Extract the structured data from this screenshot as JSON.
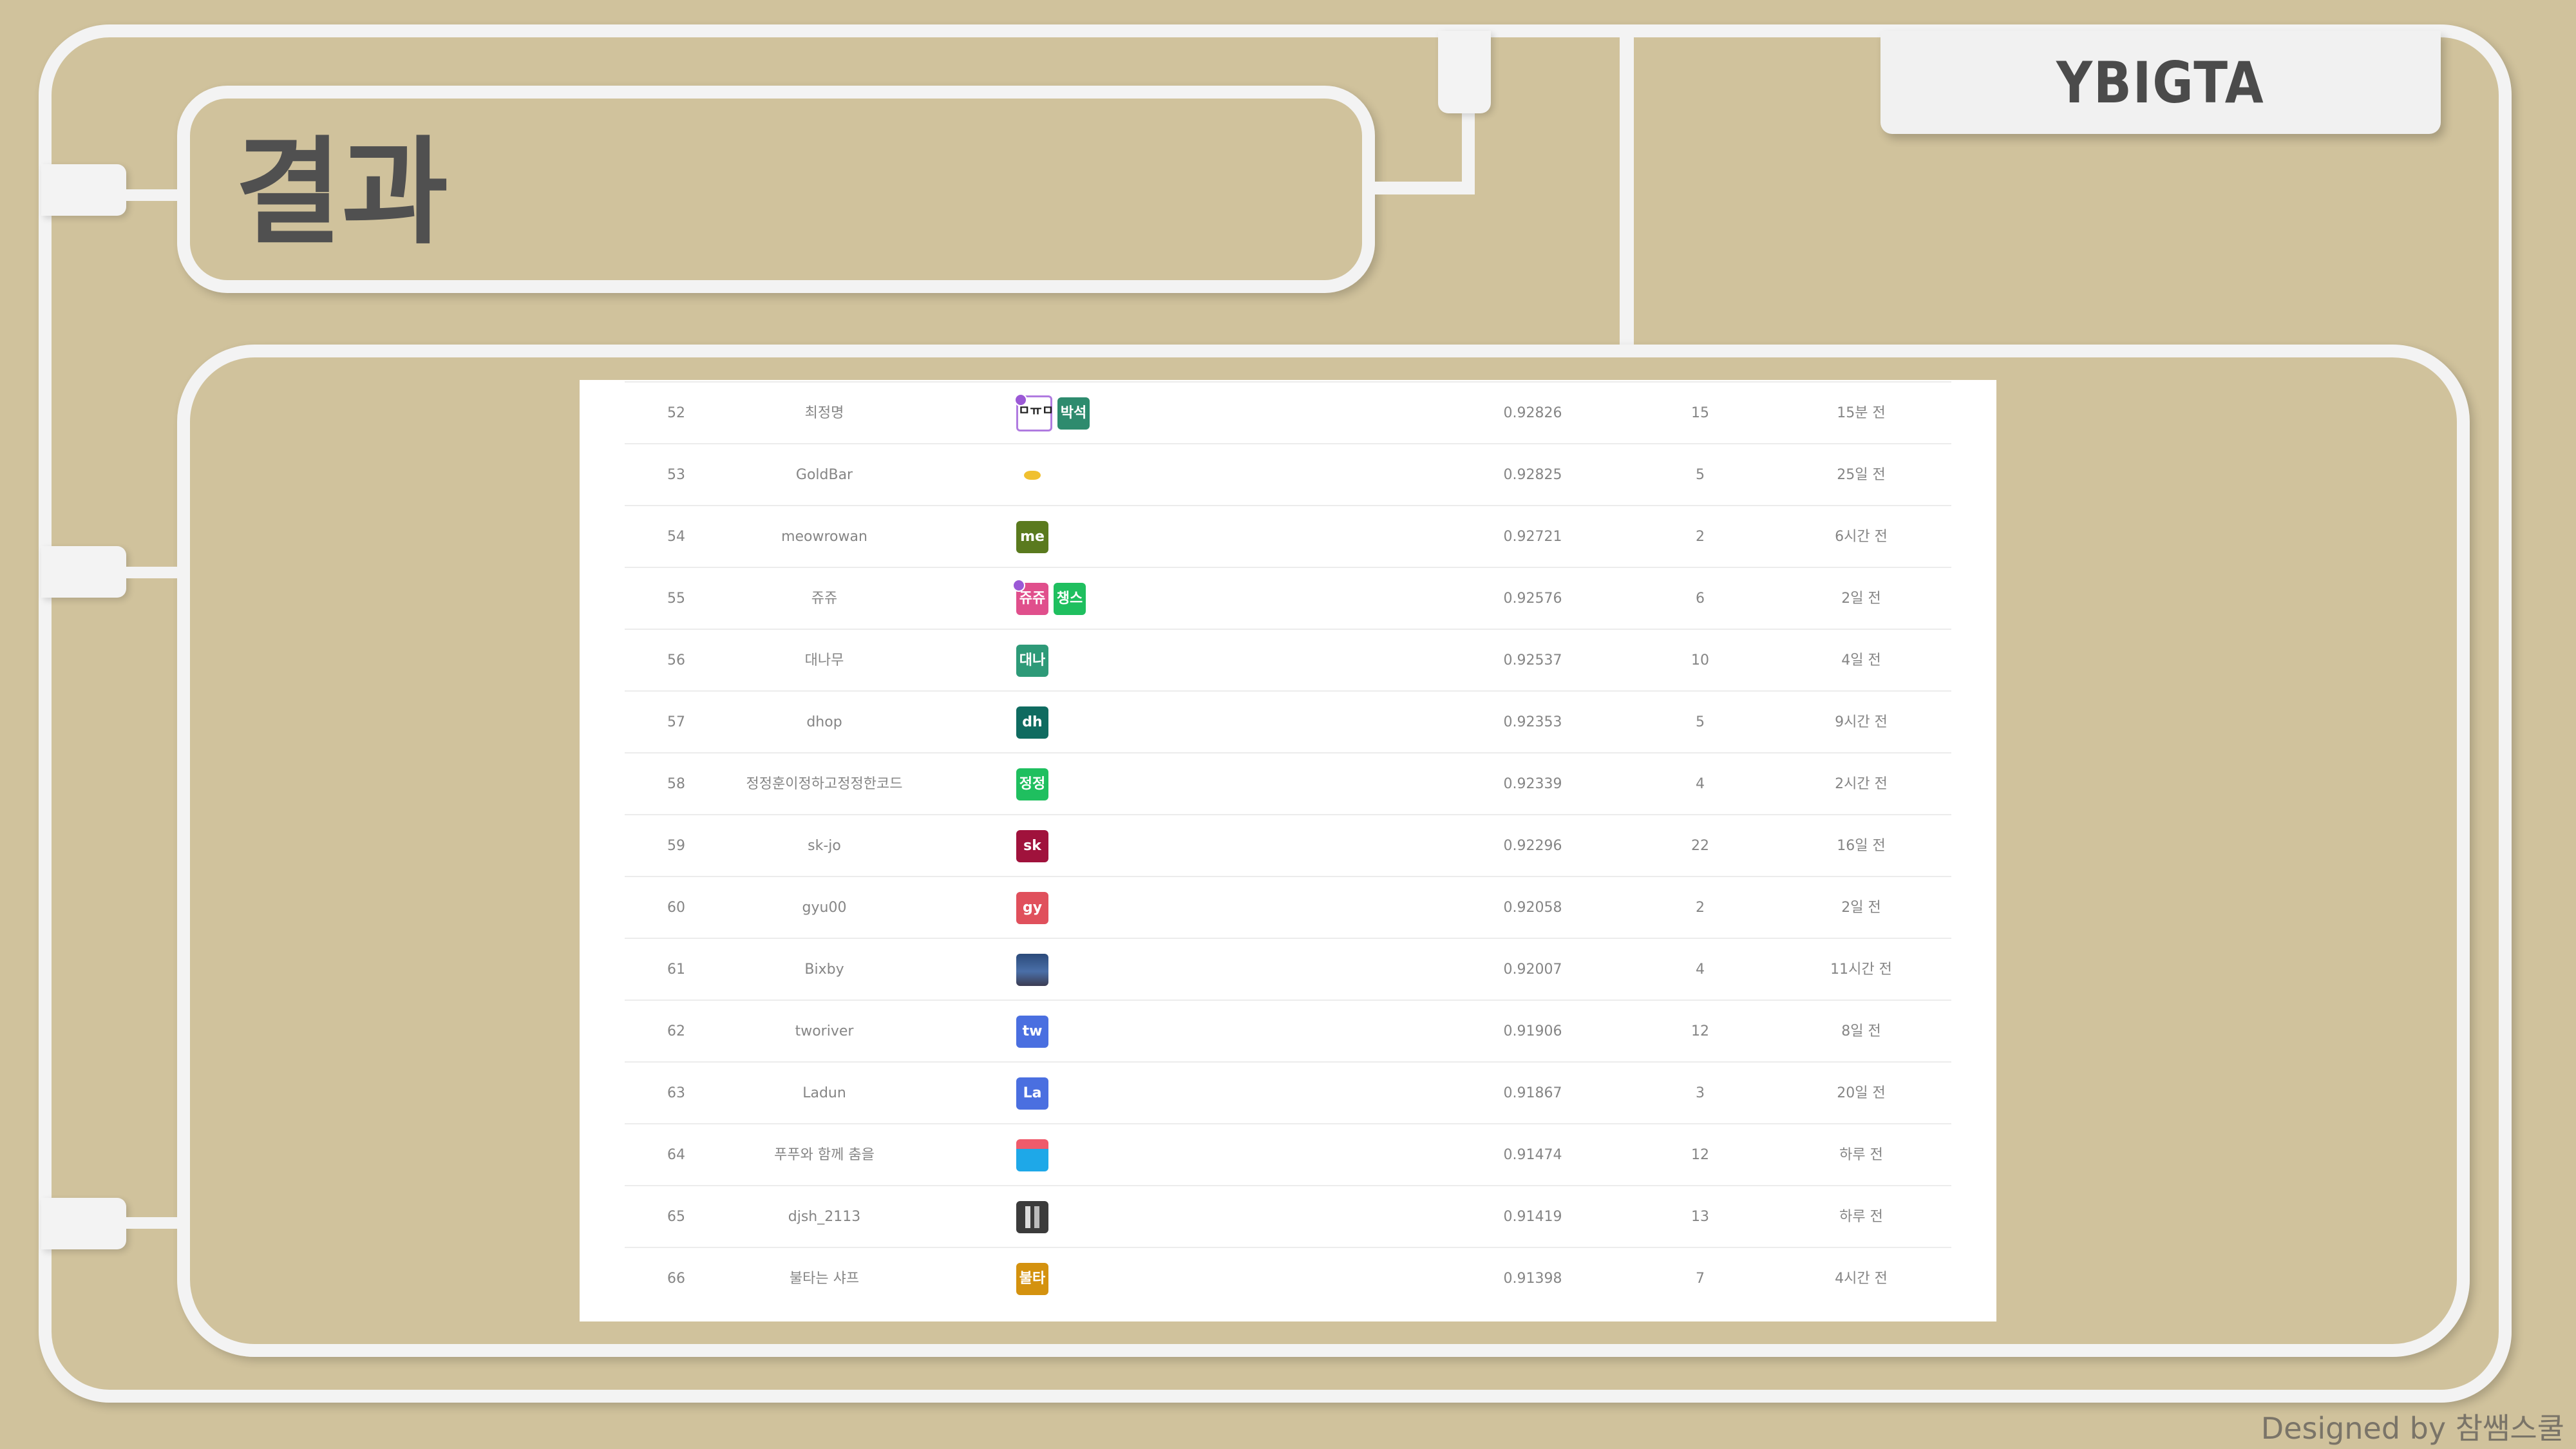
{
  "header": {
    "title": "결과",
    "logo": "YBIGTA"
  },
  "footer": {
    "credit": "Designed by 참쌤스쿨"
  },
  "leaderboard": {
    "rows": [
      {
        "rank": "52",
        "name": "최정명",
        "score": "0.92826",
        "entries": "15",
        "last": "15분 전",
        "team": [
          {
            "text": "ㅁㅠㅁ",
            "style": "img-face",
            "color": "#ffffff",
            "leader": true
          },
          {
            "text": "박석",
            "color": "#2e8b6e",
            "leader": false
          }
        ]
      },
      {
        "rank": "53",
        "name": "GoldBar",
        "score": "0.92825",
        "entries": "5",
        "last": "25일 전",
        "team": [
          {
            "text": "",
            "style": "img-gold",
            "color": "#ffffff",
            "leader": false
          }
        ]
      },
      {
        "rank": "54",
        "name": "meowrowan",
        "score": "0.92721",
        "entries": "2",
        "last": "6시간 전",
        "team": [
          {
            "text": "me",
            "color": "#5a7a1e",
            "leader": false
          }
        ]
      },
      {
        "rank": "55",
        "name": "쥬쥬",
        "score": "0.92576",
        "entries": "6",
        "last": "2일 전",
        "team": [
          {
            "text": "쥬쥬",
            "color": "#e04f8c",
            "leader": true
          },
          {
            "text": "챙스",
            "color": "#1fbf5f",
            "leader": false
          }
        ]
      },
      {
        "rank": "56",
        "name": "대나무",
        "score": "0.92537",
        "entries": "10",
        "last": "4일 전",
        "team": [
          {
            "text": "대나",
            "color": "#2e9a78",
            "leader": false
          }
        ]
      },
      {
        "rank": "57",
        "name": "dhop",
        "score": "0.92353",
        "entries": "5",
        "last": "9시간 전",
        "team": [
          {
            "text": "dh",
            "color": "#0f6b60",
            "leader": false
          }
        ]
      },
      {
        "rank": "58",
        "name": "정정훈이정하고정정한코드",
        "score": "0.92339",
        "entries": "4",
        "last": "2시간 전",
        "team": [
          {
            "text": "정정",
            "color": "#1fbf5f",
            "leader": false
          }
        ]
      },
      {
        "rank": "59",
        "name": "sk-jo",
        "score": "0.92296",
        "entries": "22",
        "last": "16일 전",
        "team": [
          {
            "text": "sk",
            "color": "#a0123c",
            "leader": false
          }
        ]
      },
      {
        "rank": "60",
        "name": "gyu00",
        "score": "0.92058",
        "entries": "2",
        "last": "2일 전",
        "team": [
          {
            "text": "gy",
            "color": "#e0505c",
            "leader": false
          }
        ]
      },
      {
        "rank": "61",
        "name": "Bixby",
        "score": "0.92007",
        "entries": "4",
        "last": "11시간 전",
        "team": [
          {
            "text": "",
            "style": "img-city",
            "color": "#3a5a8a",
            "leader": false
          }
        ]
      },
      {
        "rank": "62",
        "name": "tworiver",
        "score": "0.91906",
        "entries": "12",
        "last": "8일 전",
        "team": [
          {
            "text": "tw",
            "color": "#4a6fe0",
            "leader": false
          }
        ]
      },
      {
        "rank": "63",
        "name": "Ladun",
        "score": "0.91867",
        "entries": "3",
        "last": "20일 전",
        "team": [
          {
            "text": "La",
            "color": "#4a6fe0",
            "leader": false
          }
        ]
      },
      {
        "rank": "64",
        "name": "푸푸와 함께 춤을",
        "score": "0.91474",
        "entries": "12",
        "last": "하루 전",
        "team": [
          {
            "text": "",
            "style": "img-folder",
            "color": "#1ea8e8",
            "leader": false
          }
        ]
      },
      {
        "rank": "65",
        "name": "djsh_2113",
        "score": "0.91419",
        "entries": "13",
        "last": "하루 전",
        "team": [
          {
            "text": "",
            "style": "img-books",
            "color": "#3b3b3b",
            "leader": false
          }
        ]
      },
      {
        "rank": "66",
        "name": "불타는 샤프",
        "score": "0.91398",
        "entries": "7",
        "last": "4시간 전",
        "team": [
          {
            "text": "불타",
            "color": "#d4920f",
            "leader": false
          }
        ]
      }
    ]
  }
}
